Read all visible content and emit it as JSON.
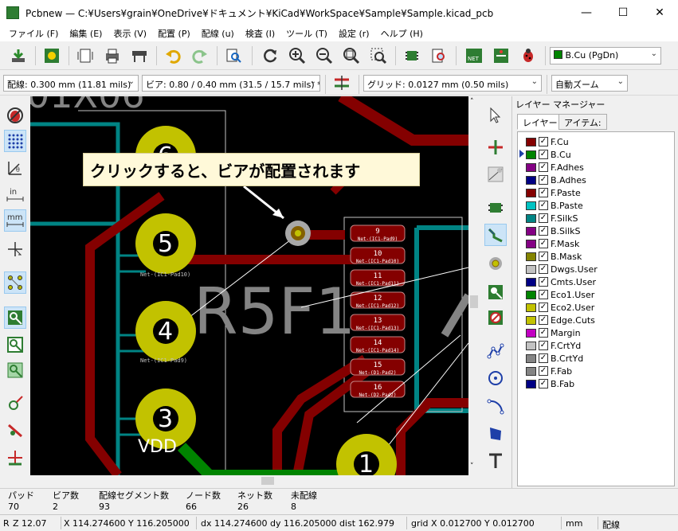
{
  "window": {
    "title": "Pcbnew — C:¥Users¥grain¥OneDrive¥ドキュメント¥KiCad¥WorkSpace¥Sample¥Sample.kicad_pcb",
    "minimize": "—",
    "maximize": "☐",
    "close": "✕"
  },
  "menubar": [
    "ファイル (F)",
    "編集 (E)",
    "表示 (V)",
    "配置 (P)",
    "配線 (u)",
    "検査 (I)",
    "ツール (T)",
    "設定 (r)",
    "ヘルプ (H)"
  ],
  "toolbar": {
    "layer_select": "B.Cu (PgDn)",
    "track_width": "配線: 0.300 mm (11.81 mils)",
    "via_size": "ビア: 0.80 / 0.40 mm (31.5 / 15.7 mils) *",
    "grid": "グリッド: 0.0127 mm (0.50 mils)",
    "zoom": "自動ズーム"
  },
  "callout": "クリックすると、ビアが配置されます",
  "canvas": {
    "silk_top": "01X06",
    "pins": [
      "6",
      "5",
      "4",
      "3",
      "1"
    ],
    "vdd": "VDD",
    "chip_ref": "R5F1",
    "ic_pads": [
      {
        "num": "9",
        "net": "Net-(IC1-Pad9)"
      },
      {
        "num": "10",
        "net": "Net-(IC1-Pad10)"
      },
      {
        "num": "11",
        "net": "Net-(IC1-Pad11)"
      },
      {
        "num": "12",
        "net": "Net-(IC1-Pad12)"
      },
      {
        "num": "13",
        "net": "Net-(IC1-Pad13)"
      },
      {
        "num": "14",
        "net": "Net-(IC1-Pad14)"
      },
      {
        "num": "15",
        "net": "Net-(D1-Pad2)"
      },
      {
        "num": "16",
        "net": "Net-(D2-Pad2)"
      }
    ],
    "pin_nets": [
      "Net-(IC1-Pad10)",
      "Net-(IC1-Pad9)"
    ]
  },
  "layer_manager": {
    "title": "レイヤー マネージャー",
    "tabs": [
      "レイヤー",
      "アイテム:"
    ],
    "active_layer": "B.Cu",
    "layers": [
      {
        "name": "F.Cu",
        "color": "#840000"
      },
      {
        "name": "B.Cu",
        "color": "#008400"
      },
      {
        "name": "F.Adhes",
        "color": "#840084"
      },
      {
        "name": "B.Adhes",
        "color": "#000084"
      },
      {
        "name": "F.Paste",
        "color": "#840000"
      },
      {
        "name": "B.Paste",
        "color": "#00c2c2"
      },
      {
        "name": "F.SilkS",
        "color": "#008484"
      },
      {
        "name": "B.SilkS",
        "color": "#840084"
      },
      {
        "name": "F.Mask",
        "color": "#840084"
      },
      {
        "name": "B.Mask",
        "color": "#848400"
      },
      {
        "name": "Dwgs.User",
        "color": "#c2c2c2"
      },
      {
        "name": "Cmts.User",
        "color": "#000084"
      },
      {
        "name": "Eco1.User",
        "color": "#008400"
      },
      {
        "name": "Eco2.User",
        "color": "#c2c200"
      },
      {
        "name": "Edge.Cuts",
        "color": "#c2c200"
      },
      {
        "name": "Margin",
        "color": "#c200c2"
      },
      {
        "name": "F.CrtYd",
        "color": "#c2c2c2"
      },
      {
        "name": "B.CrtYd",
        "color": "#848484"
      },
      {
        "name": "F.Fab",
        "color": "#848484"
      },
      {
        "name": "B.Fab",
        "color": "#000084"
      }
    ]
  },
  "stats": [
    {
      "label": "パッド",
      "value": "70"
    },
    {
      "label": "ビア数",
      "value": "2"
    },
    {
      "label": "配線セグメント数",
      "value": "93"
    },
    {
      "label": "ノード数",
      "value": "66"
    },
    {
      "label": "ネット数",
      "value": "26"
    },
    {
      "label": "未配線",
      "value": "8"
    }
  ],
  "status": {
    "zoom": "Z 12.07",
    "xy": "X 114.274600  Y 116.205000",
    "dxy": "dx 114.274600  dy 116.205000  dist 162.979",
    "grid": "grid X 0.012700  Y 0.012700",
    "units": "mm",
    "mode": "配線",
    "corner": "R"
  }
}
